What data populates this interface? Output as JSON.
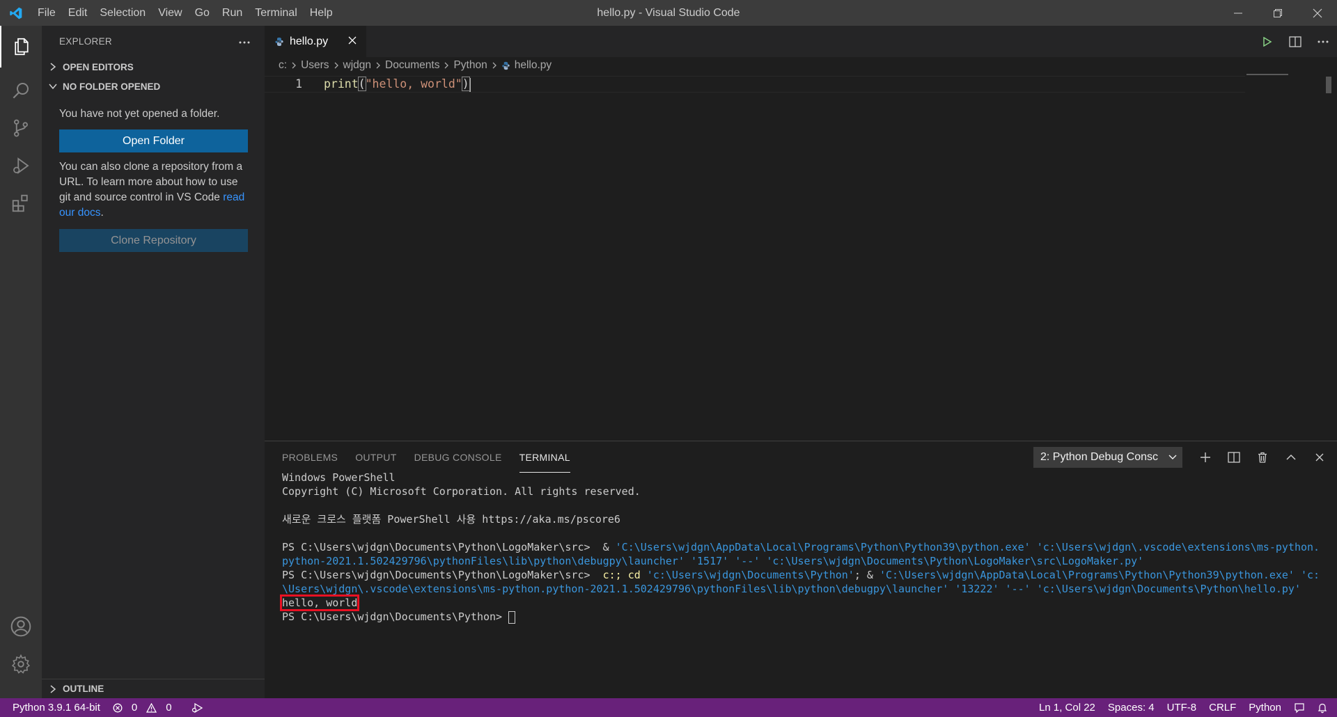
{
  "titlebar": {
    "menu": [
      "File",
      "Edit",
      "Selection",
      "View",
      "Go",
      "Run",
      "Terminal",
      "Help"
    ],
    "window_title": "hello.py - Visual Studio Code"
  },
  "sidebar": {
    "header": "EXPLORER",
    "open_editors": "OPEN EDITORS",
    "no_folder": "NO FOLDER OPENED",
    "no_folder_msg": "You have not yet opened a folder.",
    "open_folder_button": "Open Folder",
    "clone_msg_1": "You can also clone a repository from a URL. To learn more about how to use git and source control in VS Code ",
    "clone_msg_link": "read our docs",
    "clone_msg_end": ".",
    "clone_button": "Clone Repository",
    "outline": "OUTLINE"
  },
  "editor": {
    "tab_label": "hello.py",
    "breadcrumb": [
      "c:",
      "Users",
      "wjdgn",
      "Documents",
      "Python",
      "hello.py"
    ],
    "line_number": "1",
    "code_fn": "print",
    "code_open": "(",
    "code_str": "\"hello, world\"",
    "code_close": ")"
  },
  "panel": {
    "tabs": [
      "PROBLEMS",
      "OUTPUT",
      "DEBUG CONSOLE",
      "TERMINAL"
    ],
    "active_tab": "TERMINAL",
    "terminal_select": "2: Python Debug Consc",
    "terminal": {
      "l1": "Windows PowerShell",
      "l2": "Copyright (C) Microsoft Corporation. All rights reserved.",
      "l3": "새로운 크로스 플랫폼 PowerShell 사용 https://aka.ms/pscore6",
      "l4_prompt": "PS C:\\Users\\wjdgn\\Documents\\Python\\LogoMaker\\src>  & ",
      "l4_cmd": "'C:\\Users\\wjdgn\\AppData\\Local\\Programs\\Python\\Python39\\python.exe' 'c:\\Users\\wjdgn\\.vscode\\extensions\\ms-python.",
      "l5": "python-2021.1.502429796\\pythonFiles\\lib\\python\\debugpy\\launcher' '1517' '--' 'c:\\Users\\wjdgn\\Documents\\Python\\LogoMaker\\src\\LogoMaker.py'",
      "l6_prompt": "PS C:\\Users\\wjdgn\\Documents\\Python\\LogoMaker\\src>  ",
      "l6_cd": "c:; cd ",
      "l6_path": "'c:\\Users\\wjdgn\\Documents\\Python'",
      "l6_amp": "; & ",
      "l6_cmd": "'C:\\Users\\wjdgn\\AppData\\Local\\Programs\\Python\\Python39\\python.exe' 'c:",
      "l7": "\\Users\\wjdgn\\.vscode\\extensions\\ms-python.python-2021.1.502429796\\pythonFiles\\lib\\python\\debugpy\\launcher' '13222' '--' 'c:\\Users\\wjdgn\\Documents\\Python\\hello.py'",
      "l8": "hello, world",
      "l9_prompt": "PS C:\\Users\\wjdgn\\Documents\\Python> "
    }
  },
  "statusbar": {
    "interpreter": "Python 3.9.1 64-bit",
    "errors": "0",
    "warnings": "0",
    "position": "Ln 1, Col 22",
    "spaces": "Spaces: 4",
    "encoding": "UTF-8",
    "eol": "CRLF",
    "language": "Python"
  },
  "colors": {
    "statusbar": "#68217a",
    "accent_button": "#0e639c",
    "highlight_box": "#e81123"
  }
}
